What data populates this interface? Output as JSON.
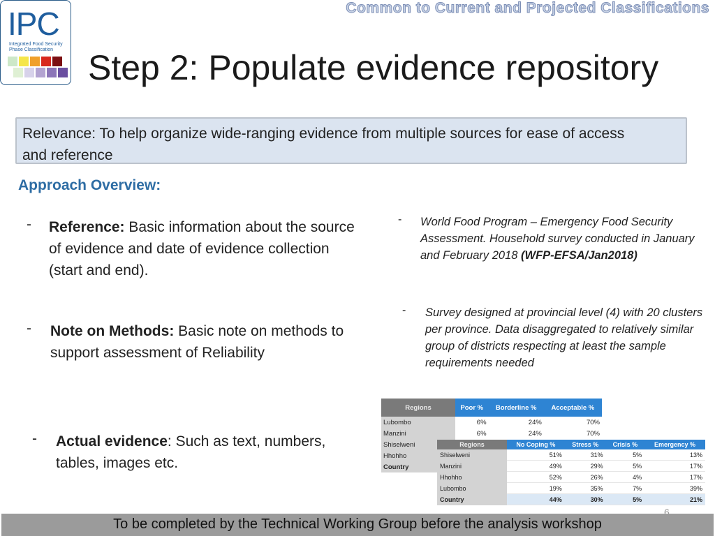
{
  "logo": {
    "text": "IPC",
    "subtitle": "Integrated Food Security Phase Classification",
    "swatch_colors": [
      "#cde8c8",
      "#f5e64a",
      "#f0a02a",
      "#d8281e",
      "#7c0f12",
      "#dff0d4",
      "#d7d2ea",
      "#b3a3d1",
      "#8c75b8",
      "#6b4fa0"
    ]
  },
  "top_banner": "Common to Current and Projected Classifications",
  "title": "Step 2: Populate evidence repository",
  "relevance": "Relevance: To help organize wide-ranging evidence from multiple sources for ease of access and reference",
  "approach_heading": "Approach Overview:",
  "left_items": [
    {
      "dash": "-",
      "label": "Reference:",
      "text": " Basic information about the source of evidence and date of evidence collection (start and end)."
    },
    {
      "dash": "-",
      "label": "Note on Methods:",
      "text": " Basic note on methods to support assessment of Reliability"
    },
    {
      "dash": "-",
      "label": "Actual evidence",
      "text": ": Such as text, numbers, tables, images etc."
    }
  ],
  "right_items": [
    {
      "dash": "-",
      "text": "World Food Program – Emergency Food Security Assessment. Household survey conducted in January and February 2018 ",
      "bold": "(WFP-EFSA/Jan2018)"
    },
    {
      "dash": "-",
      "text": "Survey designed at provincial level (4) with 20 clusters per province. Data disaggregated to relatively similar group of districts respecting at least the sample requirements needed"
    }
  ],
  "table1": {
    "headers": [
      "Regions",
      "Poor %",
      "Borderline %",
      "Acceptable %"
    ],
    "rows": [
      [
        "Lubombo",
        "6%",
        "24%",
        "70%"
      ],
      [
        "Manzini",
        "6%",
        "24%",
        "70%"
      ],
      [
        "Shiselweni",
        "",
        "",
        ""
      ],
      [
        "Hhohho",
        "",
        "",
        ""
      ],
      [
        "Country",
        "",
        "",
        ""
      ]
    ]
  },
  "table2": {
    "headers": [
      "Regions",
      "No Coping %",
      "Stress %",
      "Crisis %",
      "Emergency %"
    ],
    "rows": [
      [
        "Shiselweni",
        "51%",
        "31%",
        "5%",
        "13%"
      ],
      [
        "Manzini",
        "49%",
        "29%",
        "5%",
        "17%"
      ],
      [
        "Hhohho",
        "52%",
        "26%",
        "4%",
        "17%"
      ],
      [
        "Lubombo",
        "19%",
        "35%",
        "7%",
        "39%"
      ],
      [
        "Country",
        "44%",
        "30%",
        "5%",
        "21%"
      ]
    ]
  },
  "slide_number": "6",
  "footer": "To be completed by the Technical Working Group before the analysis workshop"
}
